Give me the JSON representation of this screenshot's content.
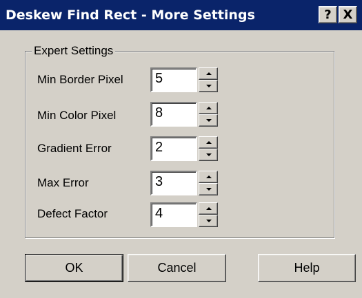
{
  "window": {
    "title": "Deskew Find Rect - More Settings",
    "help_button": "?",
    "close_button": "X"
  },
  "group": {
    "label": "Expert Settings"
  },
  "fields": [
    {
      "label": "Min Border Pixel",
      "value": "5"
    },
    {
      "label": "Min Color Pixel",
      "value": "8"
    },
    {
      "label": "Gradient Error",
      "value": "2"
    },
    {
      "label": "Max Error",
      "value": "3"
    },
    {
      "label": "Defect Factor",
      "value": "4"
    }
  ],
  "buttons": {
    "ok": "OK",
    "cancel": "Cancel",
    "help": "Help"
  }
}
